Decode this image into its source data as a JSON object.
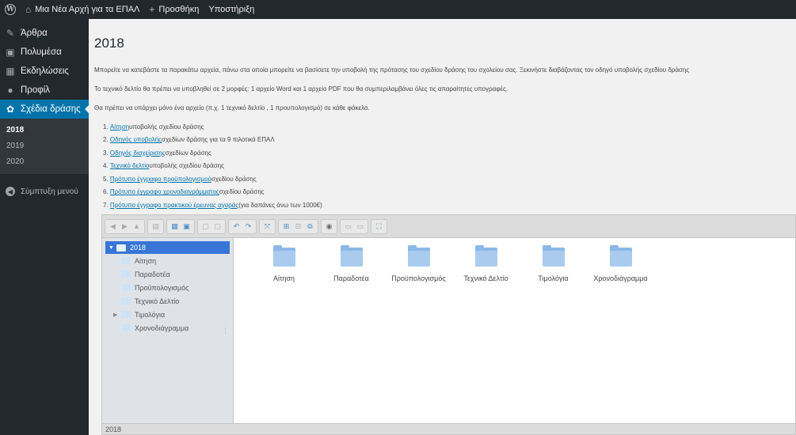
{
  "adminbar": {
    "site_name": "Μια Νέα Αρχή για τα ΕΠΑΛ",
    "new_label": "Προσθήκη",
    "support_label": "Υποστήριξη"
  },
  "sidebar": {
    "items": [
      {
        "label": "Άρθρα",
        "icon": "pin-icon"
      },
      {
        "label": "Πολυμέσα",
        "icon": "media-icon"
      },
      {
        "label": "Εκδηλώσεις",
        "icon": "calendar-icon"
      },
      {
        "label": "Προφίλ",
        "icon": "user-icon"
      },
      {
        "label": "Σχέδια δράσης",
        "icon": "gear-icon"
      }
    ],
    "submenu": [
      "2018",
      "2019",
      "2020"
    ],
    "collapse_label": "Σύμπτυξη μενού"
  },
  "page": {
    "title": "2018",
    "intro1": "Μπορείτε να κατεβάστε τα παρακάτω αρχεία, πάνω στα οποία μπορείτε να βασίσετε την υποβολή της πρότασης του σχεδίου δράσης του σχολείου σας. Ξεκινήστε διαβάζοντας τον οδηγό υποβολής σχεδίου δράσης",
    "intro2": "Το τεχνικό δελτίο θα πρέπει να υποβληθεί σε 2 μορφές: 1 αρχείο Word και 1 αρχείο PDF που θα συμπεριλαμβάνει όλες τις απαραίτητες υπογραφές.",
    "intro3": "Θα πρέπει να υπάρχει μόνο ένα αρχείο (π.χ. 1 τεχνικό δελτίο , 1 προυπολογισμό) σε κάθε φάκελο.",
    "docs": [
      {
        "num": "1.",
        "link": "Αίτηση",
        "rest": " υποβολής σχεδίου δράσης"
      },
      {
        "num": "2.",
        "link": "Οδηγός υποβολής",
        "rest": " σχεδίων δράσης για τα 9 πιλοτικά ΕΠΑΛ"
      },
      {
        "num": "3.",
        "link": "Οδηγός διαχείρισης",
        "rest": " σχεδίων δράσης"
      },
      {
        "num": "4.",
        "link": "Τεχνικό δελτίο",
        "rest": " υποβολής σχεδίου δράσης"
      },
      {
        "num": "5.",
        "link": "Πρότυπο έγγραφο προϋπολογισμού",
        "rest": " σχεδίου δράσης"
      },
      {
        "num": "6.",
        "link": "Πρότυπο έγγραφο χρονοδιαγράμματος",
        "rest": " σχεδίου δράσης"
      },
      {
        "num": "7.",
        "link": "Πρότυπο έγγραφο πρακτικού έρευνας αγοράς",
        "rest": " (για δαπάνες άνω των 1000€)"
      }
    ]
  },
  "filemanager": {
    "tree_root": "2018",
    "tree": [
      "Αίτηση",
      "Παραδοτέα",
      "Προϋπολογισμός",
      "Τεχνικό Δελτίο",
      "Τιμολόγια",
      "Χρονοδιάγραμμα"
    ],
    "files": [
      "Αίτηση",
      "Παραδοτέα",
      "Προϋπολογισμός",
      "Τεχνικό Δελτίο",
      "Τιμολόγια",
      "Χρονοδιάγραμμα"
    ],
    "status": "2018"
  },
  "colors": {
    "accent": "#0073aa",
    "adminbar": "#23282d",
    "tree_selected": "#3875d7",
    "folder": "#8bb8e6"
  }
}
